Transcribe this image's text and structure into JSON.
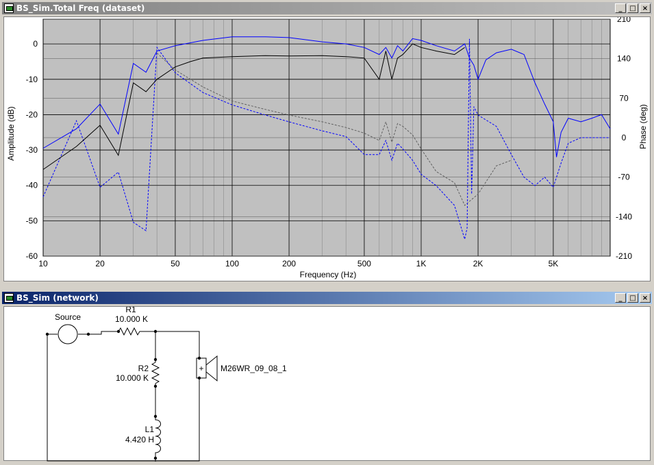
{
  "plot_window": {
    "title": "BS_Sim.Total Freq (dataset)",
    "buttons": {
      "minimize": "_",
      "maximize": "□",
      "close": "×"
    }
  },
  "network_window": {
    "title": "BS_Sim (network)",
    "buttons": {
      "minimize": "_",
      "maximize": "□",
      "close": "×"
    }
  },
  "colors": {
    "plot_bg": "#c0c0c0",
    "grid": "#000000",
    "series_black": "#000000",
    "series_blue": "#0000ff",
    "series_gray": "#606060"
  },
  "chart_data": {
    "type": "line",
    "xlabel": "Frequency (Hz)",
    "ylabel": "Amplitude (dB)",
    "y2label": "Phase (deg)",
    "xscale": "log",
    "xlim": [
      10,
      10000
    ],
    "ylim": [
      -60,
      7
    ],
    "y2lim": [
      -210,
      210
    ],
    "x_ticks": [
      "10",
      "20",
      "50",
      "100",
      "200",
      "500",
      "1K",
      "2K",
      "5K"
    ],
    "x_tick_values": [
      10,
      20,
      50,
      100,
      200,
      500,
      1000,
      2000,
      5000
    ],
    "y_ticks": [
      "0",
      "-10",
      "-20",
      "-30",
      "-40",
      "-50",
      "-60"
    ],
    "y_tick_values": [
      0,
      -10,
      -20,
      -30,
      -40,
      -50,
      -60
    ],
    "y2_ticks": [
      "210",
      "140",
      "70",
      "0",
      "-70",
      "-140",
      "-210"
    ],
    "y2_tick_values": [
      210,
      140,
      70,
      0,
      -70,
      -140,
      -210
    ],
    "series": [
      {
        "role": "blue-amplitude",
        "axis": "left",
        "style": "solid",
        "color": "#0000ff",
        "x": [
          10,
          15,
          20,
          25,
          30,
          35,
          40,
          50,
          70,
          100,
          150,
          200,
          300,
          400,
          500,
          600,
          650,
          700,
          750,
          800,
          900,
          1000,
          1200,
          1500,
          1700,
          1800,
          1900,
          2000,
          2200,
          2500,
          3000,
          3500,
          4000,
          4500,
          5000,
          5200,
          5500,
          6000,
          7000,
          8000,
          9000,
          10000
        ],
        "y": [
          -29.5,
          -24,
          -17,
          -25.5,
          -5.5,
          -8,
          -2,
          -0.5,
          1,
          2,
          2,
          1.8,
          0.6,
          0,
          -1,
          -3,
          -1,
          -4,
          -0.5,
          -2,
          1.5,
          1,
          -0.5,
          -2,
          0,
          -4,
          -6,
          -10,
          -4.5,
          -2.5,
          -1.5,
          -3,
          -11,
          -17,
          -22,
          -32,
          -25,
          -21,
          -22,
          -21,
          -20,
          -24
        ]
      },
      {
        "role": "black-amplitude",
        "axis": "left",
        "style": "solid",
        "color": "#000000",
        "x": [
          10,
          15,
          20,
          25,
          30,
          35,
          40,
          50,
          60,
          70,
          100,
          150,
          200,
          300,
          400,
          500,
          600,
          650,
          700,
          750,
          800,
          900,
          1000,
          1200,
          1500,
          1700
        ],
        "y": [
          -35.5,
          -29,
          -23,
          -31.5,
          -11,
          -13.5,
          -10,
          -6.5,
          -5,
          -4,
          -3.6,
          -3.3,
          -3.4,
          -3.3,
          -3.6,
          -4,
          -10,
          -2,
          -10,
          -4,
          -3,
          0,
          -1,
          -2,
          -3,
          -1
        ]
      },
      {
        "role": "blue-phase",
        "axis": "right",
        "style": "dashed",
        "color": "#0000ff",
        "x": [
          10,
          15,
          20,
          25,
          30,
          35,
          40,
          50,
          70,
          100,
          150,
          200,
          300,
          400,
          500,
          600,
          650,
          700,
          750,
          800,
          900,
          1000,
          1200,
          1500,
          1700,
          1750,
          1800,
          1850,
          1900,
          2000,
          2500,
          3000,
          3500,
          4000,
          4500,
          5000,
          5500,
          6000,
          7000,
          8000,
          9000,
          10000
        ],
        "y": [
          -105,
          30,
          -88,
          -61,
          -150,
          -165,
          160,
          115,
          80,
          58,
          40,
          28,
          12,
          2,
          -30,
          -30,
          -5,
          -40,
          -10,
          -20,
          -40,
          -65,
          -85,
          -120,
          -180,
          -160,
          175,
          -100,
          55,
          40,
          20,
          -30,
          -70,
          -85,
          -70,
          -88,
          -45,
          -10,
          0,
          0,
          0,
          0
        ]
      },
      {
        "role": "gray-phase",
        "axis": "right",
        "style": "dashed",
        "color": "#606060",
        "x": [
          40,
          50,
          70,
          100,
          150,
          200,
          300,
          400,
          500,
          600,
          650,
          700,
          750,
          800,
          900,
          1000,
          1200,
          1500,
          1700,
          2000,
          2500,
          3000
        ],
        "y": [
          150,
          120,
          90,
          65,
          50,
          40,
          28,
          18,
          8,
          -5,
          28,
          -8,
          25,
          20,
          5,
          -20,
          -60,
          -80,
          -120,
          -100,
          -50,
          -40
        ]
      }
    ]
  },
  "network": {
    "source_label": "Source",
    "r1_name": "R1",
    "r1_value": "10.000 K",
    "r2_name": "R2",
    "r2_value": "10.000 K",
    "l1_name": "L1",
    "l1_value": "4.420 H",
    "driver_label": "M26WR_09_08_1",
    "driver_polarity": "+"
  }
}
